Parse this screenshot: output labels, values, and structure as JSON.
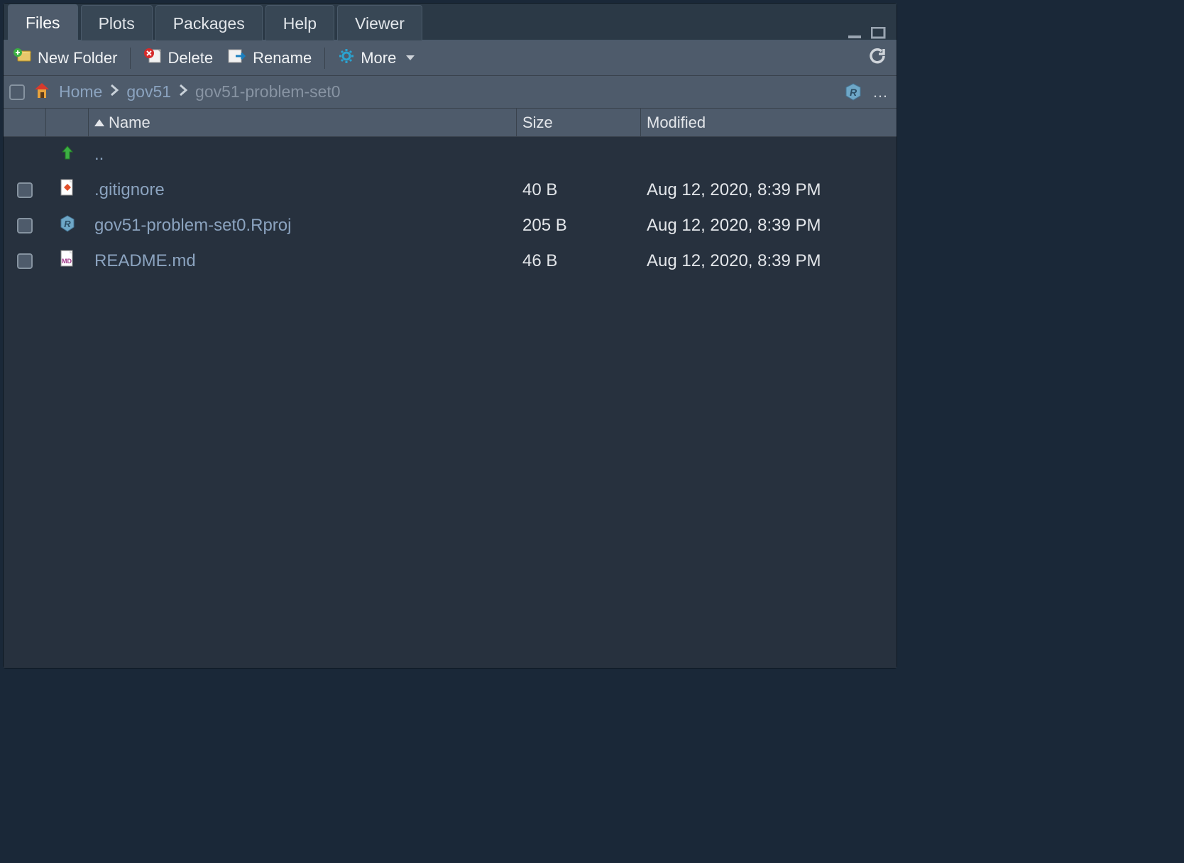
{
  "tabs": {
    "items": [
      "Files",
      "Plots",
      "Packages",
      "Help",
      "Viewer"
    ],
    "active": 0
  },
  "toolbar": {
    "new_folder": "New Folder",
    "delete": "Delete",
    "rename": "Rename",
    "more": "More"
  },
  "breadcrumb": {
    "home": "Home",
    "items": [
      "gov51",
      "gov51-problem-set0"
    ]
  },
  "columns": {
    "name": "Name",
    "size": "Size",
    "modified": "Modified"
  },
  "up_row": "..",
  "files": [
    {
      "name": ".gitignore",
      "size": "40 B",
      "modified": "Aug 12, 2020, 8:39 PM",
      "type": "git"
    },
    {
      "name": "gov51-problem-set0.Rproj",
      "size": "205 B",
      "modified": "Aug 12, 2020, 8:39 PM",
      "type": "rproj"
    },
    {
      "name": "README.md",
      "size": "46 B",
      "modified": "Aug 12, 2020, 8:39 PM",
      "type": "md"
    }
  ],
  "colors": {
    "accent": "#4e5b6b",
    "link": "#8ba3bf"
  }
}
